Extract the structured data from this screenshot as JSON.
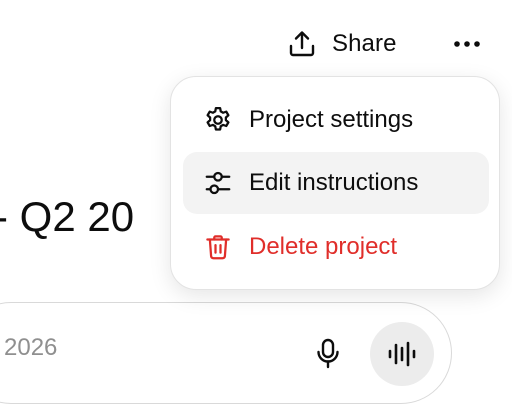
{
  "header": {
    "share_label": "Share",
    "share_icon": "share-upload-icon",
    "more_icon": "more-horizontal-icon"
  },
  "project": {
    "title_fragment": "- Q2 20"
  },
  "composer": {
    "text_fragment": "2026",
    "mic_icon": "microphone-icon",
    "voice_icon": "voice-waveform-icon"
  },
  "menu": {
    "items": [
      {
        "label": "Project settings",
        "icon": "gear-icon"
      },
      {
        "label": "Edit instructions",
        "icon": "sliders-icon",
        "highlighted": true
      },
      {
        "label": "Delete project",
        "icon": "trash-icon",
        "destructive": true
      }
    ]
  },
  "colors": {
    "danger": "#e02e2a",
    "hover_bg": "#f3f3f3",
    "voice_button_bg": "#ececec"
  }
}
